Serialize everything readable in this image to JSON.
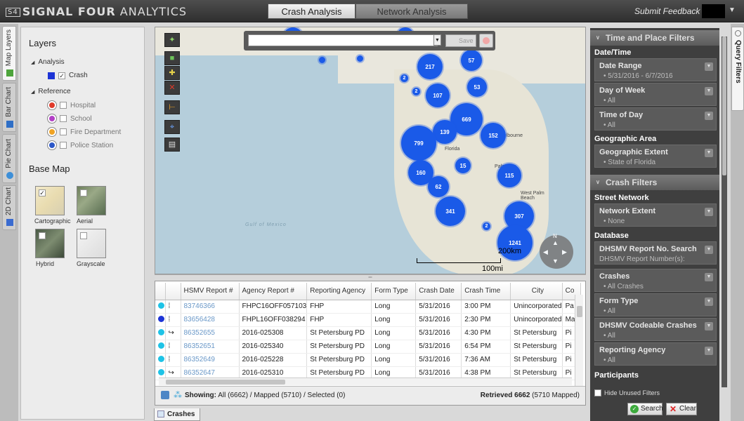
{
  "app": {
    "logo_box": "S4",
    "logo_bold": "SIGNAL FOUR",
    "logo_light": " ANALYTICS",
    "tabs": [
      {
        "label": "Crash Analysis",
        "active": true
      },
      {
        "label": "Network Analysis",
        "active": false
      }
    ],
    "feedback": "Submit Feedback"
  },
  "left_tabs": [
    {
      "label": "Map Layers",
      "icon": "map-icon",
      "active": true
    },
    {
      "label": "Bar Chart",
      "icon": "bar-chart-icon",
      "active": false
    },
    {
      "label": "Pie Chart",
      "icon": "pie-chart-icon",
      "active": false
    },
    {
      "label": "2D Chart",
      "icon": "2d-chart-icon",
      "active": false
    }
  ],
  "layers": {
    "title": "Layers",
    "analysis_label": "Analysis",
    "crash_label": "Crash",
    "reference_label": "Reference",
    "reference_items": [
      {
        "label": "Hospital",
        "color": "#e03a2a"
      },
      {
        "label": "School",
        "color": "#b23fc6"
      },
      {
        "label": "Fire Department",
        "color": "#f0a323"
      },
      {
        "label": "Police Station",
        "color": "#2b57c8"
      }
    ],
    "basemap_title": "Base Map",
    "basemaps": [
      "Cartographic",
      "Aerial",
      "Hybrid",
      "Grayscale"
    ]
  },
  "map": {
    "save_label": "Save",
    "gulf_label": "Gulf of Mexico",
    "scale_km": "200km",
    "scale_mi": "100mi",
    "north_label": "N",
    "place_labels": [
      "Palm Bay",
      "West Palm Beach",
      "Florida",
      "Melbourne"
    ],
    "clusters": [
      "217",
      "57",
      "107",
      "53",
      "669",
      "139",
      "152",
      "799",
      "15",
      "160",
      "115",
      "62",
      "341",
      "307",
      "1241",
      "2",
      "2",
      "2"
    ]
  },
  "grid": {
    "columns": [
      "",
      "",
      "HSMV Report #",
      "Agency Report #",
      "Reporting Agency",
      "Form Type",
      "Crash Date",
      "Crash Time",
      "City",
      "Co"
    ],
    "rows": [
      {
        "dot": "#1ec3e6",
        "hsmv": "83746366",
        "agency_report": "FHPC16OFF057103",
        "agency": "FHP",
        "form": "Long",
        "date": "5/31/2016",
        "time": "3:00 PM",
        "city": "Unincorporated",
        "co": "Pa"
      },
      {
        "dot": "#1d34d6",
        "hsmv": "83656428",
        "agency_report": "FHPL16OFF038294",
        "agency": "FHP",
        "form": "Long",
        "date": "5/31/2016",
        "time": "2:30 PM",
        "city": "Unincorporated",
        "co": "Ma"
      },
      {
        "dot": "#1ec3e6",
        "hsmv": "86352655",
        "agency_report": "2016-025308",
        "agency": "St Petersburg PD",
        "form": "Long",
        "date": "5/31/2016",
        "time": "4:30 PM",
        "city": "St Petersburg",
        "co": "Pi"
      },
      {
        "dot": "#1ec3e6",
        "hsmv": "86352651",
        "agency_report": "2016-025340",
        "agency": "St Petersburg PD",
        "form": "Long",
        "date": "5/31/2016",
        "time": "6:54 PM",
        "city": "St Petersburg",
        "co": "Pi"
      },
      {
        "dot": "#1ec3e6",
        "hsmv": "86352649",
        "agency_report": "2016-025228",
        "agency": "St Petersburg PD",
        "form": "Long",
        "date": "5/31/2016",
        "time": "7:36 AM",
        "city": "St Petersburg",
        "co": "Pi"
      },
      {
        "dot": "#1ec3e6",
        "hsmv": "86352647",
        "agency_report": "2016-025310",
        "agency": "St Petersburg PD",
        "form": "Long",
        "date": "5/31/2016",
        "time": "4:38 PM",
        "city": "St Petersburg",
        "co": "Pi"
      }
    ],
    "status_showing_label": "Showing:",
    "status_showing": "All (6662) / Mapped (5710) / Selected (0)",
    "status_retrieved_label": "Retrieved 6662",
    "status_retrieved": "(5710 Mapped)"
  },
  "bottom_tab": "Crashes",
  "query_filters": {
    "tab_label": "Query Filters",
    "section1": "Time and Place Filters",
    "date_time_label": "Date/Time",
    "items1": [
      {
        "title": "Date Range",
        "value": "• 5/31/2016 - 6/7/2016"
      },
      {
        "title": "Day of Week",
        "value": "• All"
      },
      {
        "title": "Time of Day",
        "value": "• All"
      }
    ],
    "geo_label": "Geographic Area",
    "geo_item": {
      "title": "Geographic Extent",
      "value": "• State of Florida"
    },
    "section2": "Crash Filters",
    "street_label": "Street Network",
    "street_item": {
      "title": "Network Extent",
      "value": "• None"
    },
    "database_label": "Database",
    "items2": [
      {
        "title": "DHSMV Report No. Search",
        "value": "DHSMV Report Number(s):"
      },
      {
        "title": "Crashes",
        "value": "• All Crashes"
      },
      {
        "title": "Form Type",
        "value": "• All"
      },
      {
        "title": "DHSMV Codeable Crashes",
        "value": "• All"
      },
      {
        "title": "Reporting Agency",
        "value": "• All"
      }
    ],
    "participants_label": "Participants",
    "hide_unused": "Hide Unused Filters",
    "search_label": "Search",
    "clear_label": "Clear"
  }
}
